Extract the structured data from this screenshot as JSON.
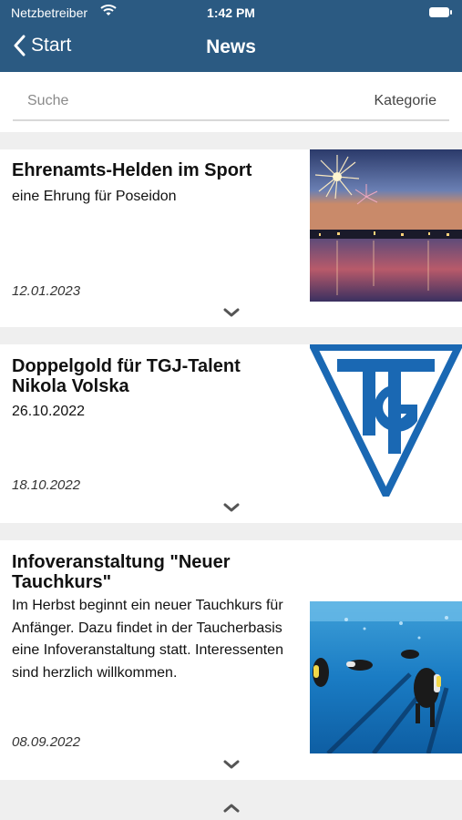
{
  "status": {
    "carrier": "Netzbetreiber",
    "time": "1:42 PM"
  },
  "nav": {
    "back_label": "Start",
    "title": "News"
  },
  "search": {
    "placeholder": "Suche",
    "category_label": "Kategorie"
  },
  "news": [
    {
      "title": "Ehrenamts-Helden im Sport",
      "subtitle": "eine Ehrung für Poseidon",
      "date": "12.01.2023",
      "image": "fireworks over lake at dusk"
    },
    {
      "title": "Doppelgold für TGJ-Talent Nikola Volska",
      "subtitle": "26.10.2022",
      "date": "18.10.2022",
      "image": "TG club logo"
    },
    {
      "title": "Infoveranstaltung \"Neuer Tauchkurs\"",
      "subtitle": "Im Herbst beginnt ein neuer Tauchkurs für Anfänger. Dazu findet in der Taucherbasis eine Infoveranstaltung statt. Interessenten sind herzlich willkommen.",
      "date": "08.09.2022",
      "image": "divers in swimming pool"
    }
  ],
  "colors": {
    "header": "#2b5a82",
    "logo_blue": "#1a68b3",
    "background": "#efefef"
  }
}
